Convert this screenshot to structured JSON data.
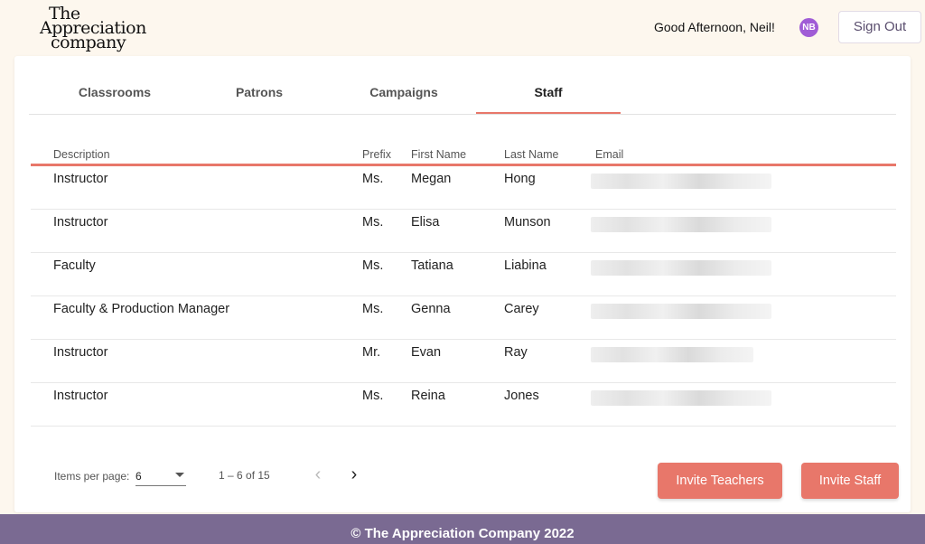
{
  "header": {
    "logo_line1": "The",
    "logo_line2": "Appreciation",
    "logo_line3": "company",
    "greeting": "Good Afternoon, Neil!",
    "avatar_initials": "NB",
    "sign_out_label": "Sign Out"
  },
  "tabs": [
    {
      "label": "Classrooms"
    },
    {
      "label": "Patrons"
    },
    {
      "label": "Campaigns"
    },
    {
      "label": "Staff",
      "active": true
    }
  ],
  "table": {
    "columns": [
      "Description",
      "Prefix",
      "First Name",
      "Last Name",
      "Email"
    ],
    "rows": [
      {
        "description": "Instructor",
        "prefix": "Ms.",
        "first_name": "Megan",
        "last_name": "Hong"
      },
      {
        "description": "Instructor",
        "prefix": "Ms.",
        "first_name": "Elisa",
        "last_name": "Munson"
      },
      {
        "description": "Faculty",
        "prefix": "Ms.",
        "first_name": "Tatiana",
        "last_name": "Liabina"
      },
      {
        "description": "Faculty & Production Manager",
        "prefix": "Ms.",
        "first_name": "Genna",
        "last_name": "Carey"
      },
      {
        "description": "Instructor",
        "prefix": "Mr.",
        "first_name": "Evan",
        "last_name": "Ray"
      },
      {
        "description": "Instructor",
        "prefix": "Ms.",
        "first_name": "Reina",
        "last_name": "Jones"
      }
    ]
  },
  "pagination": {
    "items_per_page_label": "Items per page:",
    "items_per_page_value": "6",
    "range_label": "1 – 6 of 15"
  },
  "actions": {
    "invite_teachers_label": "Invite Teachers",
    "invite_staff_label": "Invite Staff"
  },
  "footer": {
    "text": "© The Appreciation Company 2022"
  },
  "colors": {
    "accent": "#e8776a",
    "footer_bg": "#7a6a92",
    "page_bg": "#fdf7ee",
    "avatar_bg": "#a05cd6"
  }
}
